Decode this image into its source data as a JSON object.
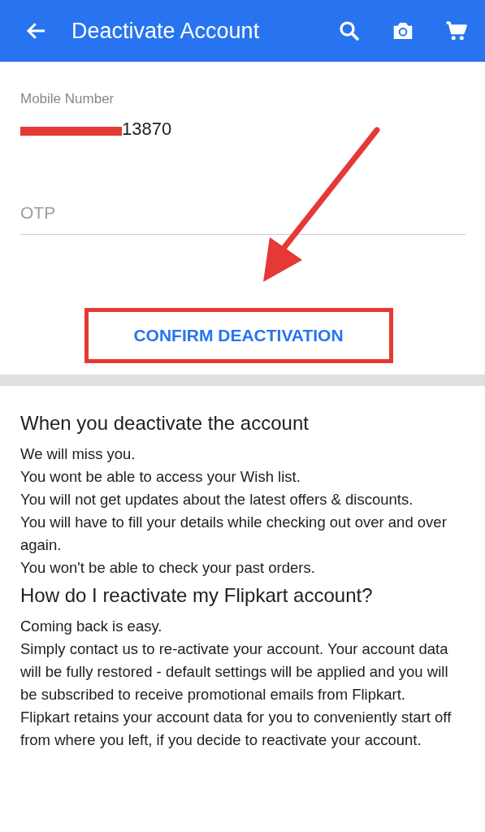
{
  "app_bar": {
    "title": "Deactivate Account"
  },
  "form": {
    "mobile_label": "Mobile Number",
    "mobile_value": "13870",
    "otp": {
      "placeholder": "OTP"
    },
    "confirm_button": "CONFIRM DEACTIVATION"
  },
  "sections": [
    {
      "heading": "When you deactivate the account",
      "lines": [
        "We will miss you.",
        "You wont be able to access your Wish list.",
        "You will not get updates about the latest offers & discounts.",
        "You will have to fill your details while checking out over and over again.",
        "You won't be able to check your past orders."
      ]
    },
    {
      "heading": "How do I reactivate my Flipkart account?",
      "lines": [
        "Coming back is easy.",
        "Simply contact us to re-activate your account. Your account data will be fully restored - default settings will be applied and you will be subscribed to receive promotional emails from Flipkart.",
        "Flipkart retains your account data for you to conveniently start off from where you left, if you decide to reactivate your account."
      ]
    }
  ]
}
